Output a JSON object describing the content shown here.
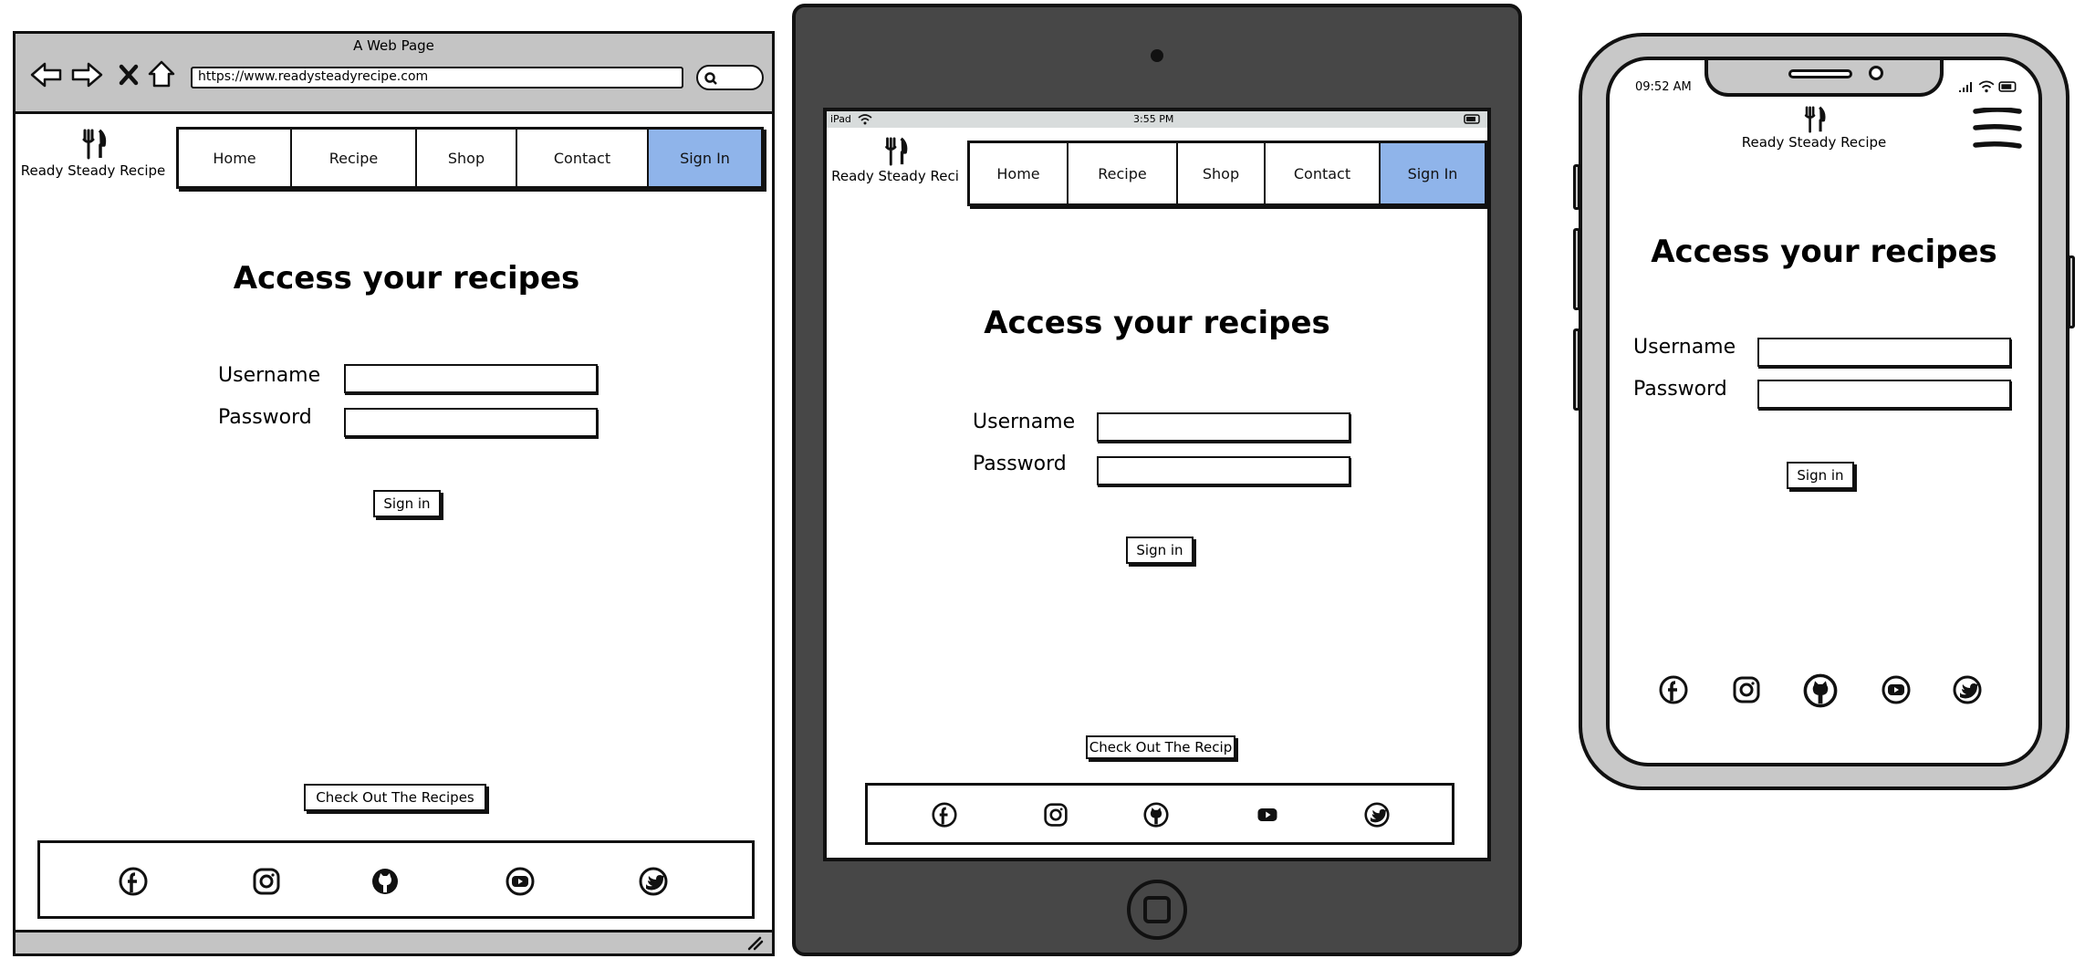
{
  "browser": {
    "window_title": "A Web Page",
    "url": "https://www.readysteadyrecipe.com",
    "nav_icons": [
      "back-arrow-icon",
      "forward-arrow-icon",
      "close-icon",
      "home-icon"
    ],
    "search_icon": "search-icon",
    "resize_icon": "resize-grip-icon"
  },
  "site": {
    "brand": "Ready Steady Recipe",
    "brand_tablet": "Ready Steady Reci",
    "logo_icon": "fork-knife-icon",
    "nav": [
      "Home",
      "Recipe",
      "Shop",
      "Contact",
      "Sign In"
    ],
    "active_nav": "Sign In",
    "heading": "Access your recipes",
    "username_label": "Username",
    "password_label": "Password",
    "signin_button": "Sign in",
    "cta_button": "Check Out The Recipes",
    "cta_button_tablet": "Check Out The Recip",
    "social_icons": [
      "facebook-icon",
      "instagram-icon",
      "github-icon",
      "youtube-icon",
      "twitter-icon"
    ]
  },
  "tablet_status": {
    "device": "iPad",
    "time": "3:55 PM"
  },
  "phone_status": {
    "time": "09:52 AM"
  },
  "colors": {
    "active_nav": "#8fb4ea",
    "chrome": "#c4c4c4",
    "tablet_body": "#474747",
    "phone_body": "#c8c8c8"
  }
}
